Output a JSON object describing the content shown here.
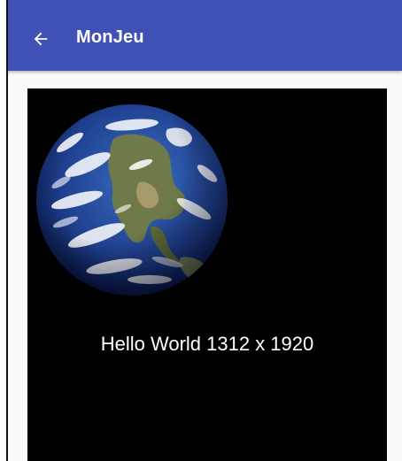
{
  "app_bar": {
    "title": "MonJeu",
    "back_icon": "arrow-back-icon",
    "color": "#3f51b5"
  },
  "canvas": {
    "background": "#000000",
    "image": "earth-globe-image",
    "message": "Hello World 1312 x 1920"
  }
}
